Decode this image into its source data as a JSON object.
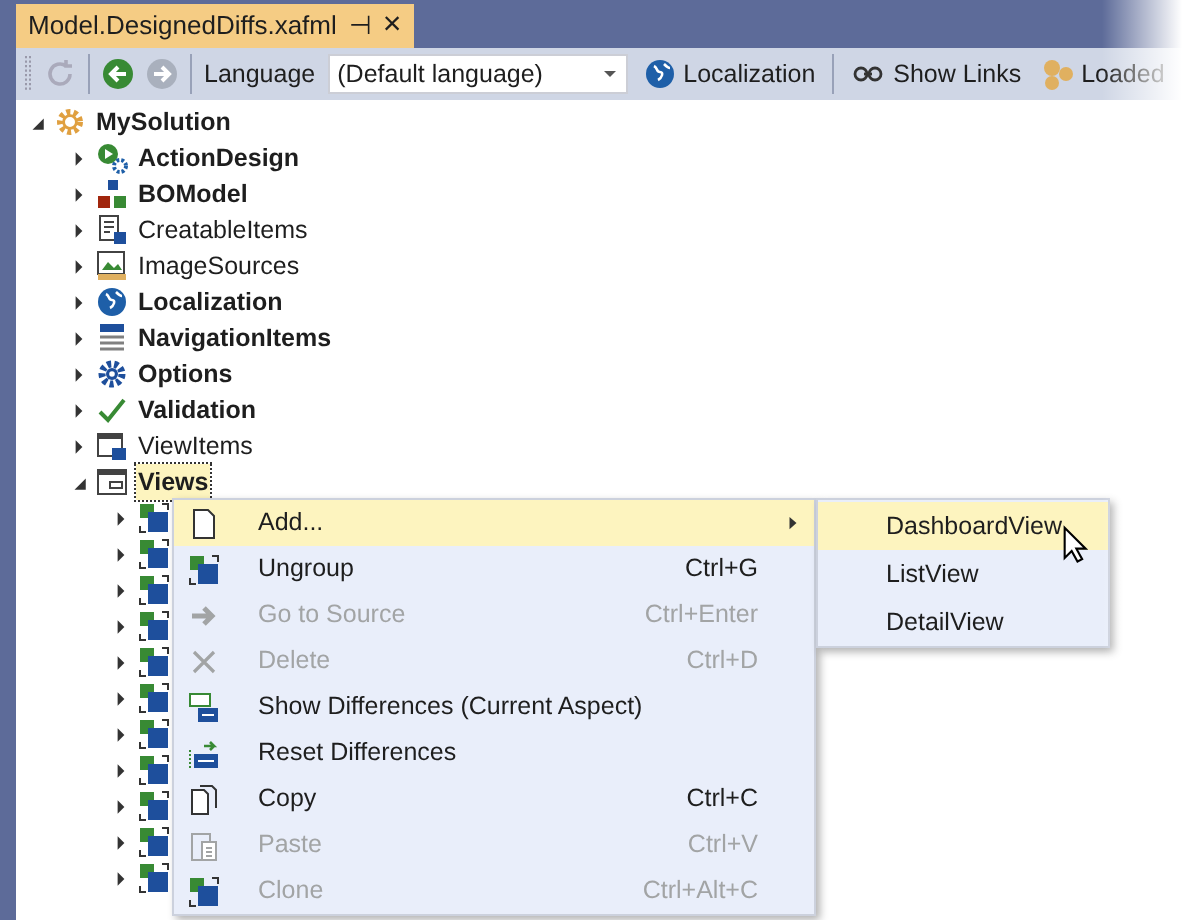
{
  "document_tab": {
    "title": "Model.DesignedDiffs.xafml",
    "pin": "⊣",
    "close": "×",
    "selected": true
  },
  "toolbar": {
    "language_label": "Language",
    "language_value": "(Default language)",
    "buttons": [
      {
        "kind": "globe",
        "label": "Localization"
      },
      {
        "kind": "link",
        "label": "Show Links"
      },
      {
        "kind": "loaded",
        "label": "Loaded"
      }
    ]
  },
  "tree": [
    {
      "label": "MySolution",
      "kind": "gear",
      "bold": true,
      "expanded": true,
      "children": [
        {
          "label": "ActionDesign",
          "kind": "action",
          "bold": true,
          "expanded": false
        },
        {
          "label": "BOModel",
          "kind": "bomodel",
          "bold": true,
          "expanded": false
        },
        {
          "label": "CreatableItems",
          "kind": "creatable",
          "bold": false,
          "expanded": false
        },
        {
          "label": "ImageSources",
          "kind": "image",
          "bold": false,
          "expanded": false
        },
        {
          "label": "Localization",
          "kind": "globe",
          "bold": true,
          "expanded": false
        },
        {
          "label": "NavigationItems",
          "kind": "nav",
          "bold": true,
          "expanded": false
        },
        {
          "label": "Options",
          "kind": "gearblue",
          "bold": true,
          "expanded": false
        },
        {
          "label": "Validation",
          "kind": "check",
          "bold": true,
          "expanded": false
        },
        {
          "label": "ViewItems",
          "kind": "viewitems",
          "bold": false,
          "expanded": false
        },
        {
          "label": "Views",
          "kind": "views",
          "bold": true,
          "expanded": true,
          "selected": true,
          "children": [
            {
              "kind": "view",
              "expanded": false
            },
            {
              "kind": "view",
              "expanded": false
            },
            {
              "kind": "view",
              "expanded": false
            },
            {
              "kind": "view",
              "expanded": false
            },
            {
              "kind": "view",
              "expanded": false
            },
            {
              "kind": "view",
              "expanded": false
            },
            {
              "kind": "view",
              "expanded": false
            },
            {
              "kind": "view",
              "expanded": false
            },
            {
              "kind": "view",
              "expanded": false
            },
            {
              "kind": "view",
              "expanded": false
            },
            {
              "kind": "view",
              "expanded": false
            }
          ]
        }
      ]
    }
  ],
  "context_menu": [
    {
      "kind": "page",
      "label": "Add...",
      "disabled": false,
      "submenu": true,
      "selected": true
    },
    {
      "kind": "ungroup",
      "label": "Ungroup",
      "shortcut": "Ctrl+G",
      "disabled": false,
      "submenu": false,
      "selected": false
    },
    {
      "kind": "arrow",
      "label": "Go to Source",
      "shortcut": "Ctrl+Enter",
      "disabled": true,
      "submenu": false,
      "selected": false
    },
    {
      "kind": "delete",
      "label": "Delete",
      "shortcut": "Ctrl+D",
      "disabled": true,
      "submenu": false,
      "selected": false
    },
    {
      "kind": "xml",
      "label": "Show Differences (Current Aspect)",
      "disabled": false,
      "submenu": false,
      "selected": false
    },
    {
      "kind": "xmlreset",
      "label": "Reset Differences",
      "disabled": false,
      "submenu": false,
      "selected": false
    },
    {
      "kind": "copy",
      "label": "Copy",
      "shortcut": "Ctrl+C",
      "disabled": false,
      "submenu": false,
      "selected": false
    },
    {
      "kind": "paste",
      "label": "Paste",
      "shortcut": "Ctrl+V",
      "disabled": true,
      "submenu": false,
      "selected": false
    },
    {
      "kind": "ungroup",
      "label": "Clone",
      "shortcut": "Ctrl+Alt+C",
      "disabled": true,
      "submenu": false,
      "selected": false
    }
  ],
  "submenu": [
    {
      "label": "DashboardView",
      "selected": true
    },
    {
      "label": "ListView",
      "selected": false
    },
    {
      "label": "DetailView",
      "selected": false
    }
  ]
}
